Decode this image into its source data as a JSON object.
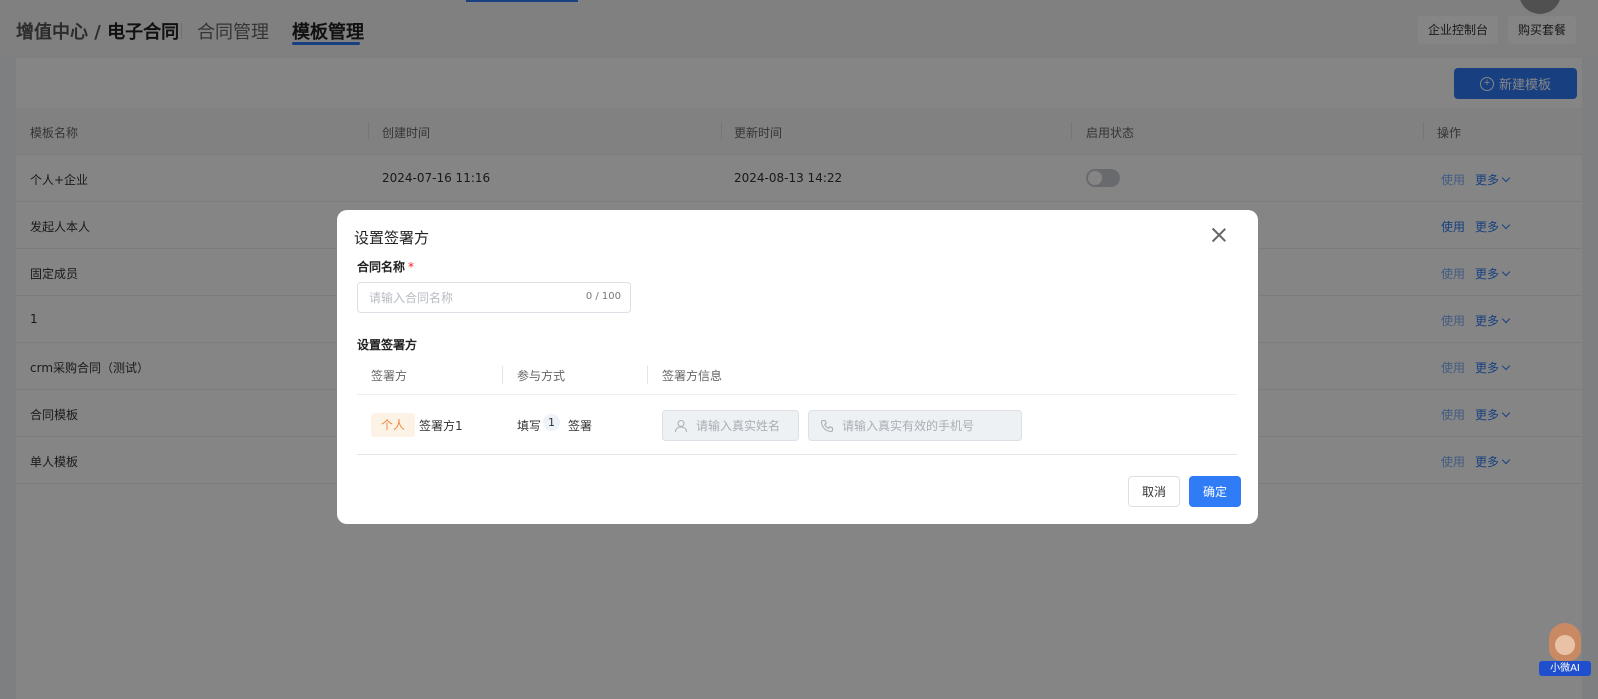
{
  "header": {
    "breadcrumb_prefix": "增值中心 / ",
    "breadcrumb_current": "电子合同",
    "tabs": [
      {
        "label": "合同管理",
        "active": false
      },
      {
        "label": "模板管理",
        "active": true
      }
    ],
    "buttons": {
      "console": "企业控制台",
      "buy": "购买套餐"
    }
  },
  "toolbar": {
    "new_template": "新建模板"
  },
  "table": {
    "columns": [
      "模板名称",
      "创建时间",
      "更新时间",
      "启用状态",
      "操作"
    ],
    "rows": [
      {
        "name": "个人+企业",
        "created": "2024-07-16 11:16",
        "updated": "2024-08-13 14:22",
        "enabled": false
      },
      {
        "name": "发起人本人"
      },
      {
        "name": "固定成员"
      },
      {
        "name": "1"
      },
      {
        "name": "crm采购合同（测试）"
      },
      {
        "name": "合同模板"
      },
      {
        "name": "单人模板"
      }
    ],
    "actions": {
      "use": "使用",
      "more": "更多"
    }
  },
  "modal": {
    "title": "设置签署方",
    "contract_name": {
      "label": "合同名称",
      "required_mark": "*",
      "placeholder": "请输入合同名称",
      "counter": "0 / 100",
      "value": ""
    },
    "signers_section": {
      "label": "设置签署方",
      "columns": [
        "签署方",
        "参与方式",
        "签署方信息"
      ],
      "rows": [
        {
          "type_tag": "个人",
          "name": "签署方1",
          "fill_label": "填写",
          "order": "1",
          "sign_label": "签署",
          "name_placeholder": "请输入真实姓名",
          "phone_placeholder": "请输入真实有效的手机号"
        }
      ]
    },
    "buttons": {
      "cancel": "取消",
      "confirm": "确定"
    }
  },
  "assistant": {
    "label": "小微AI"
  },
  "colors": {
    "primary": "#2f7cf6",
    "tag_bg": "#fdf2e6",
    "tag_text": "#f08a3c"
  }
}
